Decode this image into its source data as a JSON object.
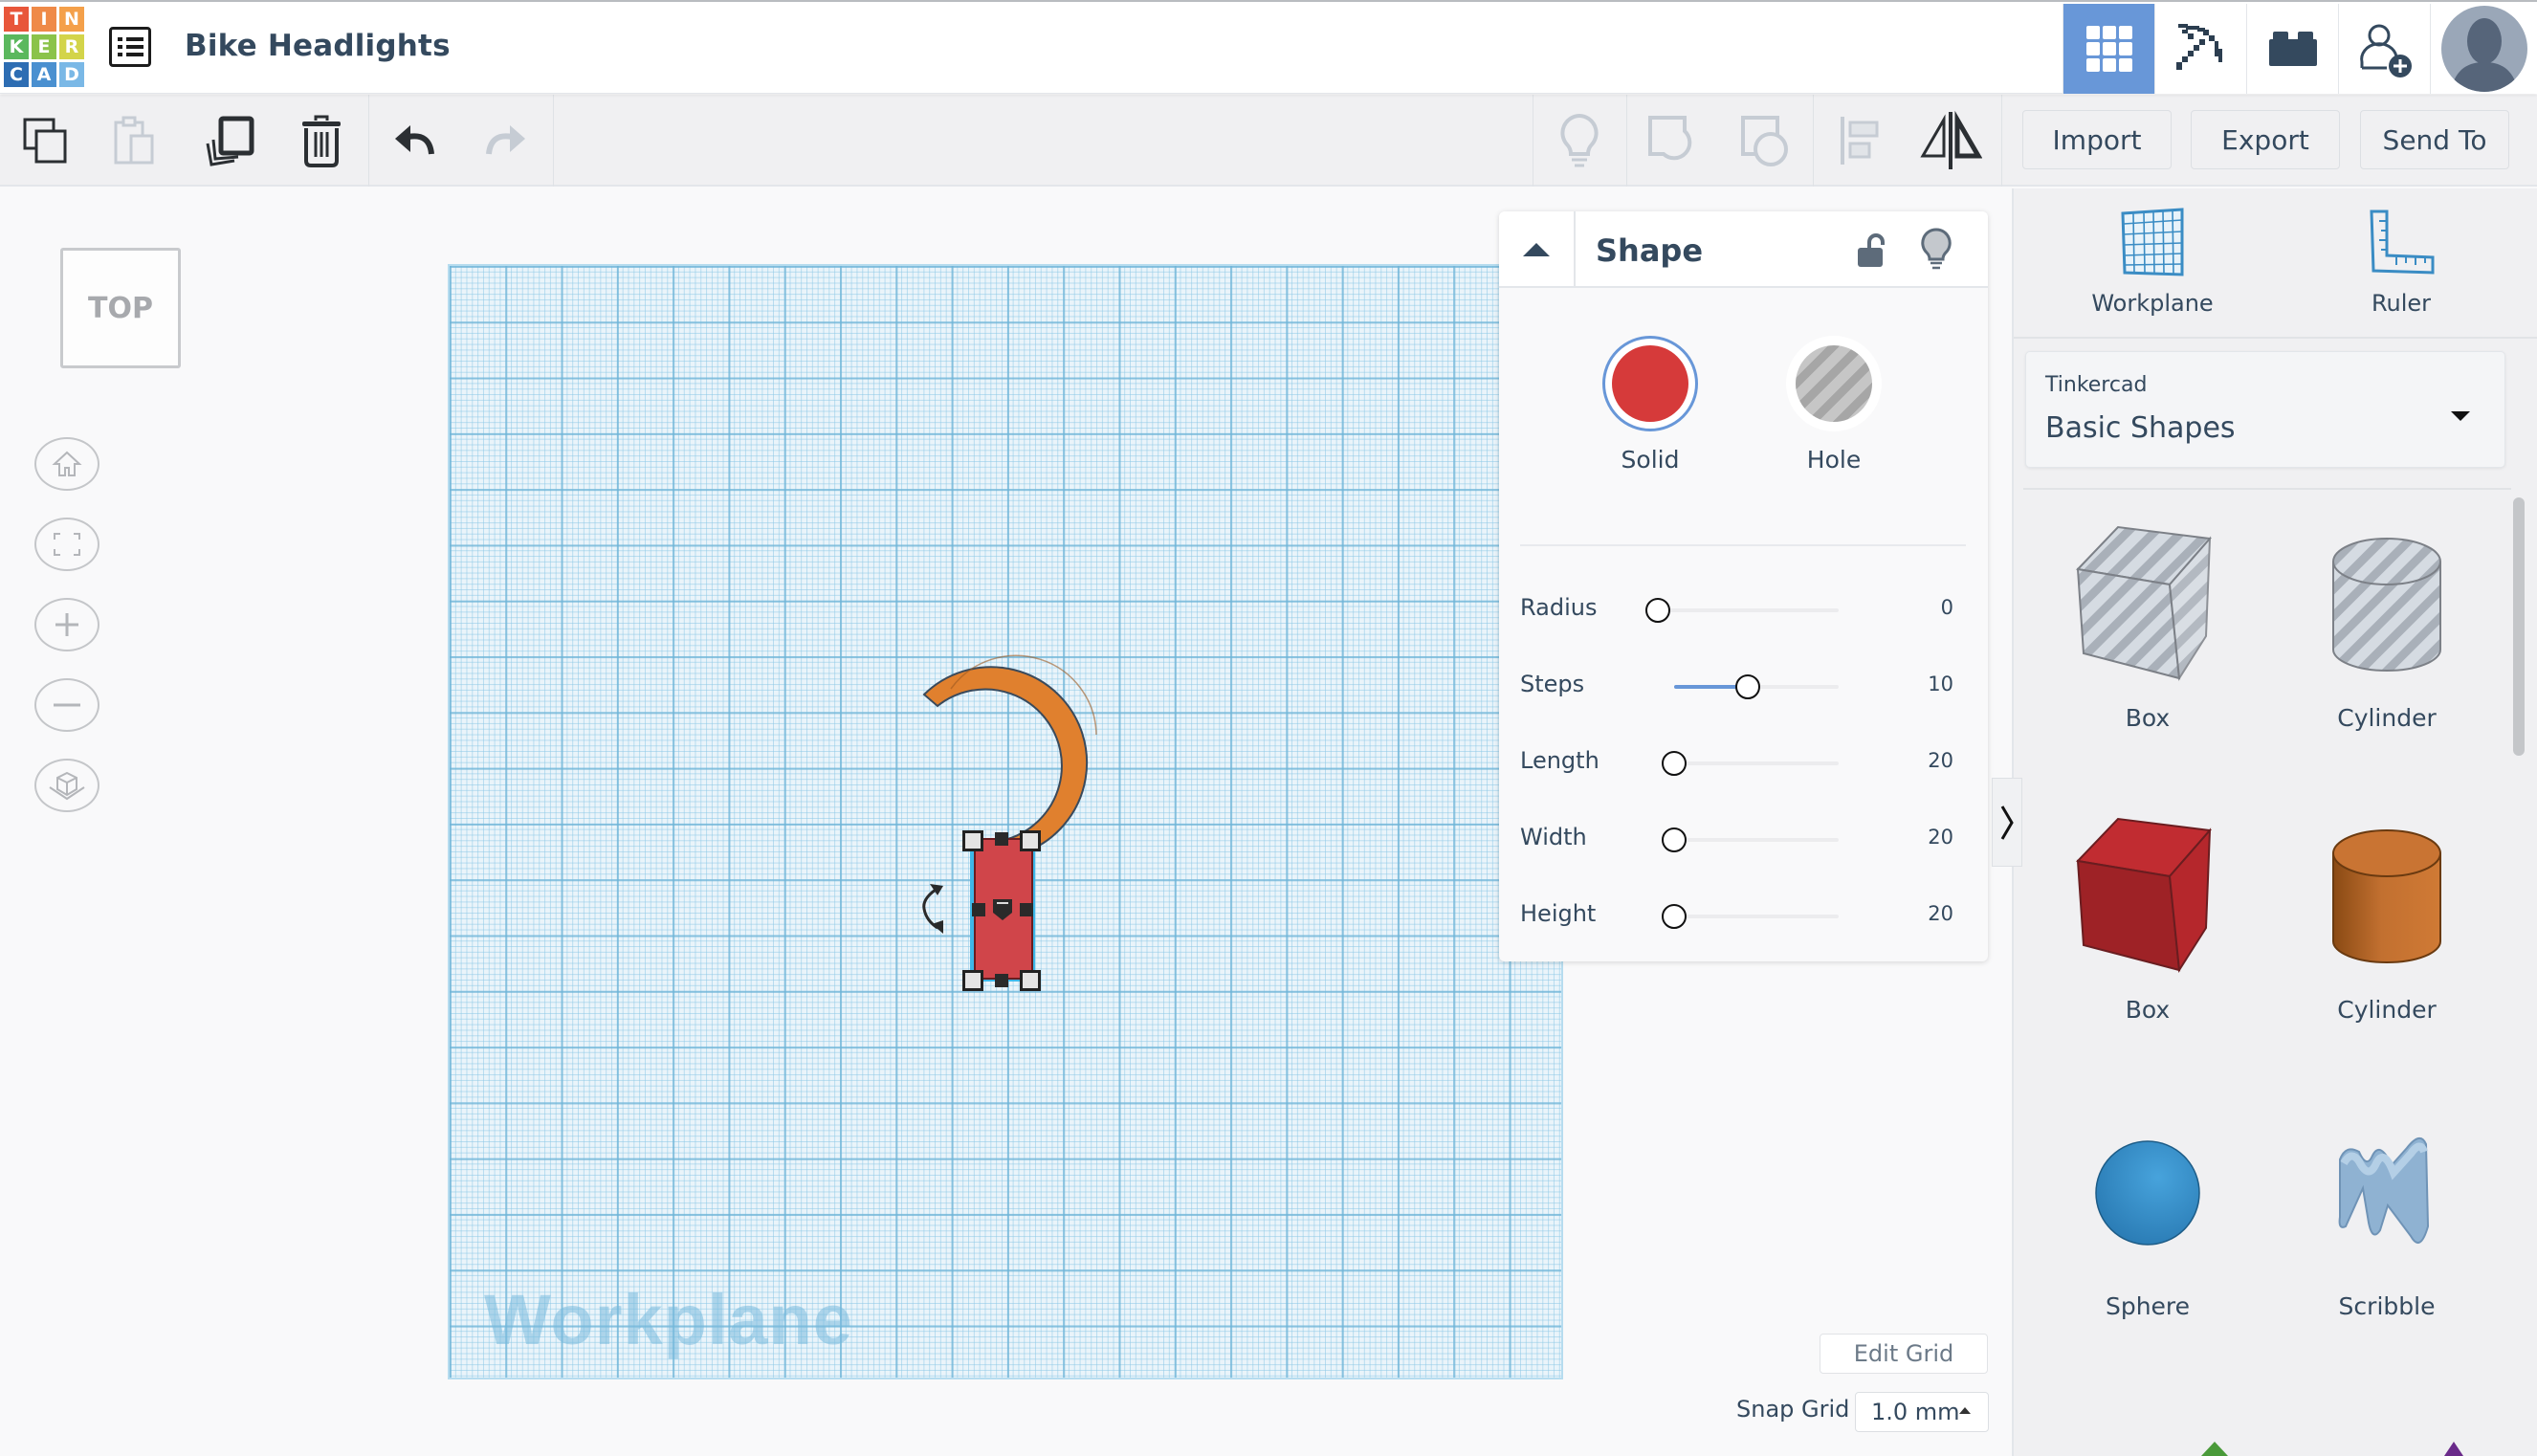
{
  "app": {
    "logo_letters": [
      "T",
      "I",
      "N",
      "K",
      "E",
      "R",
      "C",
      "A",
      "D"
    ],
    "logo_colors": [
      "#e8563a",
      "#ef8a48",
      "#f4a04a",
      "#5bb85d",
      "#8bc34a",
      "#d3d44a",
      "#2d6db3",
      "#4a90d0",
      "#7ab8e6"
    ],
    "title": "Bike Headlights"
  },
  "header": {
    "buttons": [
      {
        "name": "3d-design-view",
        "icon": "grid-icon",
        "active": true
      },
      {
        "name": "minecraft-view",
        "icon": "pickaxe-icon",
        "active": false
      },
      {
        "name": "bricks-view",
        "icon": "brick-icon",
        "active": false
      },
      {
        "name": "invite-people",
        "icon": "add-user-icon",
        "active": false
      },
      {
        "name": "user-profile",
        "icon": "avatar",
        "active": false
      }
    ]
  },
  "toolbar": {
    "copy": "copy-icon",
    "paste": "paste-icon",
    "duplicate": "duplicate-icon",
    "delete": "trash-icon",
    "undo": "undo-icon",
    "redo": "redo-icon",
    "show_all": "lightbulb-icon",
    "group": "group-icon",
    "ungroup": "ungroup-icon",
    "align": "align-icon",
    "mirror": "mirror-icon",
    "import_label": "Import",
    "export_label": "Export",
    "send_to_label": "Send To"
  },
  "viewport": {
    "view_cube_label": "TOP",
    "nav": [
      "home-icon",
      "fit-view-icon",
      "zoom-in-icon",
      "zoom-out-icon",
      "perspective-icon"
    ],
    "workplane_label": "Workplane",
    "edit_grid_label": "Edit Grid",
    "snap_grid_label": "Snap Grid",
    "snap_grid_value": "1.0 mm"
  },
  "inspector": {
    "title": "Shape",
    "solid_label": "Solid",
    "hole_label": "Hole",
    "solid_color": "#d63a3a",
    "selected": "Solid",
    "properties": [
      {
        "label": "Radius",
        "value": "0",
        "fraction": 0.0
      },
      {
        "label": "Steps",
        "value": "10",
        "fraction": 0.45
      },
      {
        "label": "Length",
        "value": "20",
        "fraction": 0.0
      },
      {
        "label": "Width",
        "value": "20",
        "fraction": 0.0
      },
      {
        "label": "Height",
        "value": "20",
        "fraction": 0.0
      }
    ]
  },
  "sidebar": {
    "workplane_label": "Workplane",
    "ruler_label": "Ruler",
    "library_provider": "Tinkercad",
    "library_name": "Basic Shapes",
    "shapes": [
      {
        "label": "Box",
        "kind": "box-hole"
      },
      {
        "label": "Cylinder",
        "kind": "cylinder-hole"
      },
      {
        "label": "Box",
        "kind": "box-solid"
      },
      {
        "label": "Cylinder",
        "kind": "cylinder-solid"
      },
      {
        "label": "Sphere",
        "kind": "sphere"
      },
      {
        "label": "Scribble",
        "kind": "scribble"
      }
    ]
  },
  "colors": {
    "accent": "#6897d8",
    "text": "#34495e",
    "orange_shape": "#e0802e",
    "red_shape": "#d0454a"
  }
}
